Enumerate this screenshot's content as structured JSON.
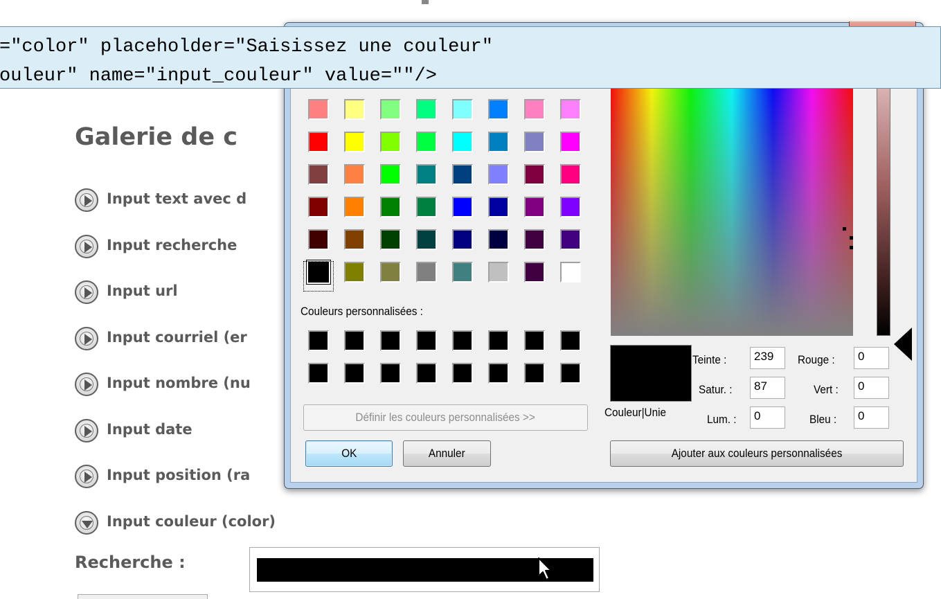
{
  "tooltip": {
    "line1": "=\"color\" placeholder=\"Saisissez une couleur\"",
    "line2": "ouleur\" name=\"input_couleur\" value=\"\"/>"
  },
  "page": {
    "title": "Galerie de c",
    "nav_items": [
      {
        "label": "Input text avec d",
        "icon": "arrow-right-circle-icon"
      },
      {
        "label": "Input recherche",
        "icon": "arrow-right-circle-icon"
      },
      {
        "label": "Input url",
        "icon": "arrow-right-circle-icon"
      },
      {
        "label": "Input courriel (er",
        "icon": "arrow-right-circle-icon"
      },
      {
        "label": "Input nombre (nu",
        "icon": "arrow-right-circle-icon"
      },
      {
        "label": "Input date",
        "icon": "arrow-right-circle-icon"
      },
      {
        "label": "Input position (ra",
        "icon": "arrow-right-circle-icon"
      },
      {
        "label": "Input couleur (color)",
        "icon": "arrow-down-circle-icon"
      }
    ],
    "search_label": "Recherche :",
    "color_input_value": "#000000"
  },
  "dialog": {
    "basic_colors": [
      [
        "#ff8080",
        "#ffff80",
        "#80ff80",
        "#00ff80",
        "#80ffff",
        "#0080ff",
        "#ff80c0",
        "#ff80ff"
      ],
      [
        "#ff0000",
        "#ffff00",
        "#80ff00",
        "#00ff40",
        "#00ffff",
        "#0080c0",
        "#8080c0",
        "#ff00ff"
      ],
      [
        "#804040",
        "#ff8040",
        "#00ff00",
        "#008080",
        "#004080",
        "#8080ff",
        "#800040",
        "#ff0080"
      ],
      [
        "#800000",
        "#ff8000",
        "#008000",
        "#008040",
        "#0000ff",
        "#0000a0",
        "#800080",
        "#8000ff"
      ],
      [
        "#400000",
        "#804000",
        "#004000",
        "#004040",
        "#000080",
        "#000040",
        "#400040",
        "#400080"
      ],
      [
        "#000000",
        "#808000",
        "#808040",
        "#808080",
        "#408080",
        "#c0c0c0",
        "#400040",
        "#ffffff"
      ]
    ],
    "selected_basic_color": "#000000",
    "custom_colors_label": "Couleurs personnalisées :",
    "custom_colors": [
      [
        "#000000",
        "#000000",
        "#000000",
        "#000000",
        "#000000",
        "#000000",
        "#000000",
        "#000000"
      ],
      [
        "#000000",
        "#000000",
        "#000000",
        "#000000",
        "#000000",
        "#000000",
        "#000000",
        "#000000"
      ]
    ],
    "define_custom_button": "Définir les couleurs personnalisées >>",
    "ok_button": "OK",
    "cancel_button": "Annuler",
    "preview_label": "Couleur|Unie",
    "hue_label": "Teinte :",
    "hue_value": "239",
    "sat_label": "Satur. :",
    "sat_value": "87",
    "lum_label": "Lum. :",
    "lum_value": "0",
    "red_label": "Rouge :",
    "red_value": "0",
    "green_label": "Vert :",
    "green_value": "0",
    "blue_label": "Bleu :",
    "blue_value": "0",
    "add_custom_button": "Ajouter aux couleurs personnalisées"
  }
}
